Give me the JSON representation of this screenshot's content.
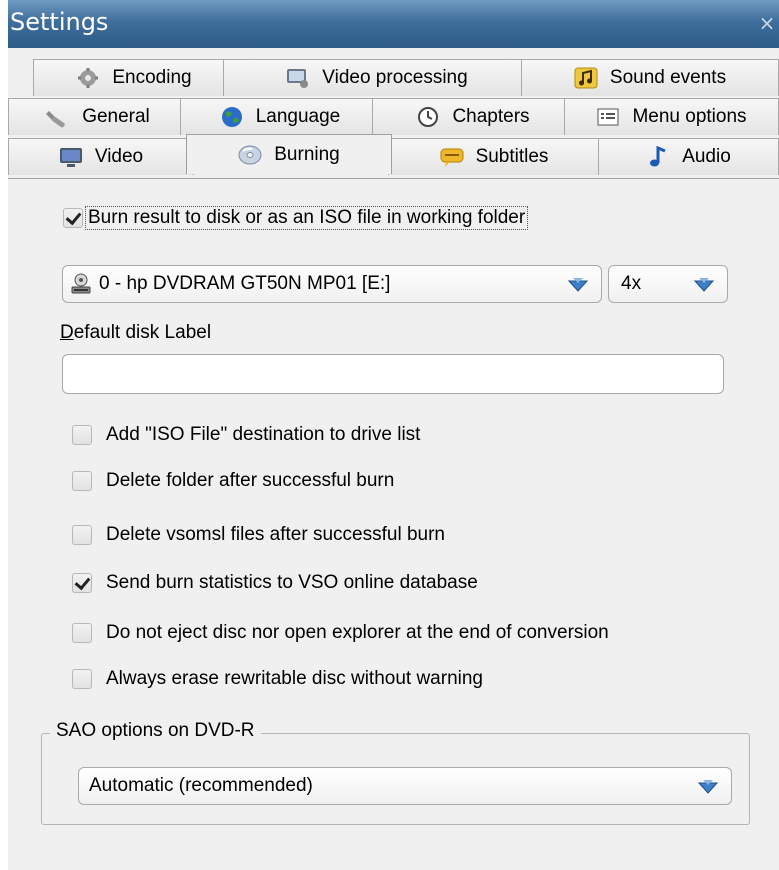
{
  "window": {
    "title": "Settings",
    "close_glyph": "×"
  },
  "tabs": {
    "row1": [
      {
        "label": "Encoding",
        "icon": "gears-icon"
      },
      {
        "label": "Video processing",
        "icon": "video-processing-icon"
      },
      {
        "label": "Sound events",
        "icon": "music-note-icon"
      }
    ],
    "row2": [
      {
        "label": "General",
        "icon": "wrench-icon"
      },
      {
        "label": "Language",
        "icon": "globe-icon"
      },
      {
        "label": "Chapters",
        "icon": "clock-icon"
      },
      {
        "label": "Menu options",
        "icon": "menu-list-icon"
      }
    ],
    "row3": [
      {
        "label": "Video",
        "icon": "monitor-icon"
      },
      {
        "label": "Burning",
        "icon": "disc-icon",
        "active": true
      },
      {
        "label": "Subtitles",
        "icon": "subtitle-bubble-icon"
      },
      {
        "label": "Audio",
        "icon": "music-note-icon"
      }
    ]
  },
  "burning": {
    "burn_result": {
      "label": "Burn result to disk or as an ISO file in working folder",
      "checked": true
    },
    "drive_select": {
      "value": "0 - hp DVDRAM GT50N MP01 [E:]",
      "icon": "drive-icon"
    },
    "speed_select": {
      "value": "4x"
    },
    "disk_label": {
      "label": "Default disk Label",
      "mnemonic": "D",
      "value": ""
    },
    "options": [
      {
        "label": "Add \"ISO File\" destination to drive list",
        "checked": false
      },
      {
        "label": "Delete folder after successful burn",
        "checked": false
      },
      {
        "label": "Delete vsomsl files after successful burn",
        "checked": false
      },
      {
        "label": "Send burn statistics to VSO online database",
        "checked": true
      },
      {
        "label": "Do not eject disc nor open explorer at the end of conversion",
        "checked": false
      },
      {
        "label": "Always erase rewritable disc without warning",
        "checked": false
      }
    ],
    "sao": {
      "legend": "SAO options on DVD-R",
      "value": "Automatic (recommended)"
    }
  },
  "colors": {
    "titlebar": "#3f6e9c",
    "panel": "#f0f0f0",
    "arrow": "#3f7fc8"
  }
}
